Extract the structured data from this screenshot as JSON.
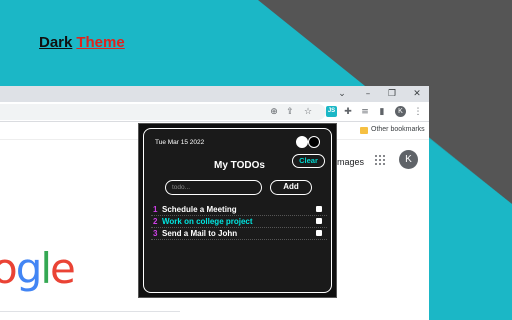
{
  "hero": {
    "title_part1": "Dark",
    "title_part2": "Theme"
  },
  "colors": {
    "teal": "#1bb7c6",
    "dark_gray": "#555555",
    "accent_red": "#e0231b",
    "cyan_text": "#00e5e0",
    "magenta_num": "#d040e8"
  },
  "browser": {
    "bookmarks_label": "Other bookmarks",
    "ext_badge": "JS",
    "profile_initial": "K",
    "page_link_images": "mages",
    "logo_text": "ogle"
  },
  "popup": {
    "date": "Tue Mar 15 2022",
    "title": "My TODOs",
    "clear_label": "Clear",
    "input_placeholder": "todo...",
    "add_label": "Add",
    "todos": [
      {
        "num": "1",
        "text": "Schedule a Meeting"
      },
      {
        "num": "2",
        "text": "Work on college project"
      },
      {
        "num": "3",
        "text": "Send a Mail to John"
      }
    ]
  }
}
